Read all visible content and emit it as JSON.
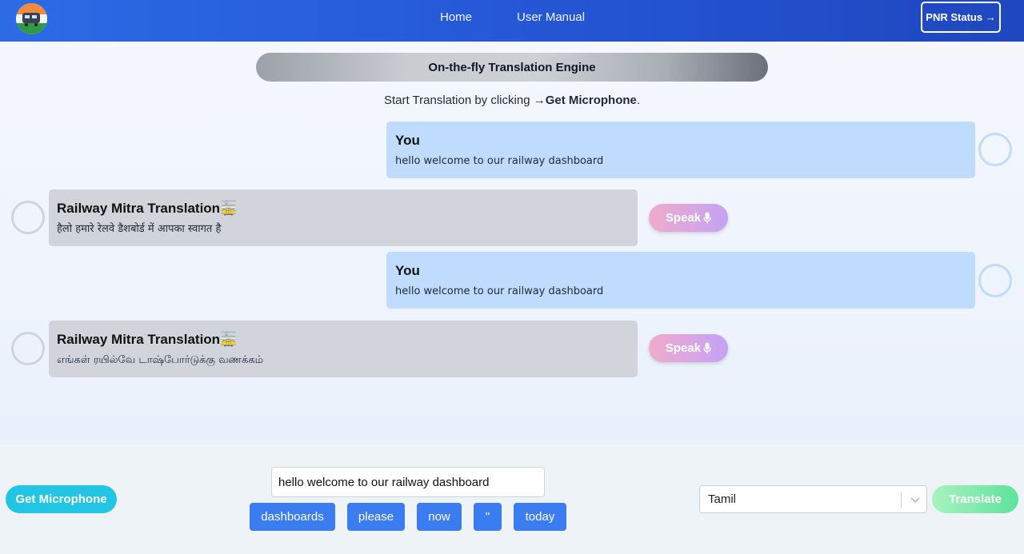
{
  "header": {
    "logo_icon": "train-logo-icon",
    "nav": [
      {
        "label": "Home"
      },
      {
        "label": "User Manual"
      }
    ],
    "pnr_button": "PNR Status →"
  },
  "main": {
    "title": "On-the-fly Translation Engine",
    "instruction_prefix": "Start Translation by clicking →",
    "instruction_bold": "Get Microphone",
    "instruction_suffix": ".",
    "messages": [
      {
        "sender": "You",
        "text": "hello welcome to our railway dashboard"
      },
      {
        "sender": "Railway Mitra Translation🚋",
        "text": "हैलो हमारे रेलवे डैशबोर्ड में आपका स्वागत है",
        "speak_label": "Speak"
      },
      {
        "sender": "You",
        "text": "hello welcome to our railway dashboard"
      },
      {
        "sender": "Railway Mitra Translation🚋",
        "text": "எங்கள் ரயில்வே டாஷ்போர்டுக்கு வணக்கம்",
        "speak_label": "Speak"
      }
    ]
  },
  "footer": {
    "mic_button": "Get Microphone",
    "input_value": "hello welcome to our railway dashboard",
    "suggestions": [
      "dashboards",
      "please",
      "now",
      "\"",
      "today"
    ],
    "language_selected": "Tamil",
    "translate_button": "Translate"
  },
  "colors": {
    "navbar": "#2557d6",
    "you_bubble": "#bfdbfe",
    "bot_bubble": "#d1d5db",
    "chip": "#3b7cf0",
    "mic": "#22c6e4",
    "translate": "#5ee39a"
  }
}
